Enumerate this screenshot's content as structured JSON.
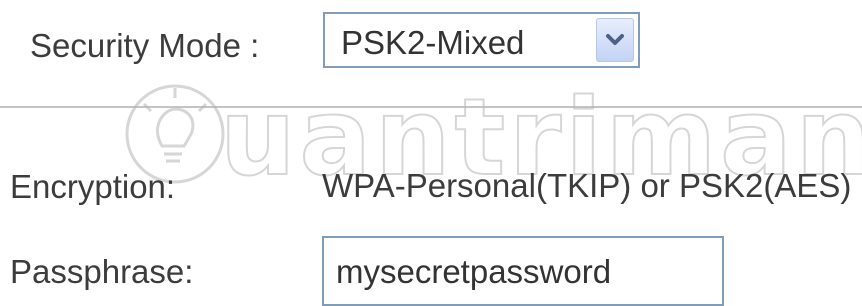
{
  "security_mode": {
    "label": "Security Mode :",
    "selected_value": "PSK2-Mixed",
    "dropdown_icon": "chevron-down-icon"
  },
  "encryption": {
    "label": "Encryption:",
    "value": "WPA-Personal(TKIP) or PSK2(AES)"
  },
  "passphrase": {
    "label": "Passphrase:",
    "value": "mysecretpassword"
  },
  "watermark": {
    "text": "uantrimang",
    "icon": "lightbulb-icon"
  },
  "colors": {
    "field_border": "#7f9db9",
    "dropdown_button": "#c3d3f5",
    "arrow": "#4d6185",
    "divider": "#c4c4c4"
  }
}
